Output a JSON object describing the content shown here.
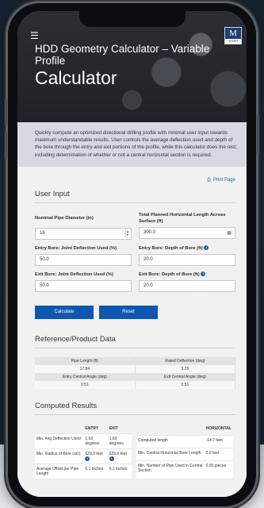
{
  "header": {
    "subtitle": "HDD Geometry Calculator – Variable Profile",
    "title": "Calculator",
    "logo_letter": "M",
    "logo_text": "WARD"
  },
  "intro": "Quickly compute an optimized directional drilling profile with minimal user input towards maximum understandable results. User controls the average deflection used and depth of the bore through the entry and exit portions of the profile, while this calculator does the rest; including determination of whether or not a central horizontal section is required.",
  "print_label": "Print Page",
  "user_input": {
    "title": "User Input",
    "pipe_diameter_label": "Nominal Pipe Diameter (in)",
    "pipe_diameter_value": "16",
    "horizontal_length_label": "Total Planned Horizontal Length Across Surface (ft)",
    "horizontal_length_value": "300.0",
    "entry_deflection_label": "Entry Bore: Joint Deflection Used (%)",
    "entry_deflection_value": "50.0",
    "entry_depth_label": "Entry Bore: Depth of Bore (ft)",
    "entry_depth_value": "20.0",
    "exit_deflection_label": "Exit Bore: Joint Deflection Used (%)",
    "exit_deflection_value": "50.0",
    "exit_depth_label": "Exit Bore: Depth of Bore (ft)",
    "exit_depth_value": "20.0",
    "calculate_label": "Calculate",
    "reset_label": "Reset"
  },
  "reference": {
    "title": "Reference/Product Data",
    "pipe_length_label": "Pipe Length (ft)",
    "pipe_length_value": "17.84",
    "rated_deflection_label": "Rated Deflection (deg)",
    "rated_deflection_value": "3.25",
    "entry_angle_label": "Entry Central Angle (deg)",
    "entry_angle_value": "0.51",
    "exit_angle_label": "Exit Central Angle (deg)",
    "exit_angle_value": "0.51"
  },
  "computed": {
    "title": "Computed Results",
    "col_entry": "ENTRY",
    "col_exit": "EXIT",
    "col_horizontal": "HORIZONTAL",
    "left_rows": [
      {
        "label": "Min. Avg Deflection Used",
        "entry": "1.63 degrees",
        "exit": "1.63 degrees"
      },
      {
        "label": "Min. Radius of Bore (arc)",
        "entry": "629.0 feet",
        "exit": "629.0 feet"
      },
      {
        "label": "Average Offset per Pipe Length",
        "entry": "6.1 inches",
        "exit": "6.1 inches"
      }
    ],
    "right_rows": [
      {
        "label": "Computed length",
        "value": "-14.7 feet"
      },
      {
        "label": "Min. Central Horizontal Bore Length",
        "value": "0.0 feet"
      },
      {
        "label": "Min. Number of Pipe Used in Central Section",
        "value": "0.00 pieces"
      }
    ]
  }
}
